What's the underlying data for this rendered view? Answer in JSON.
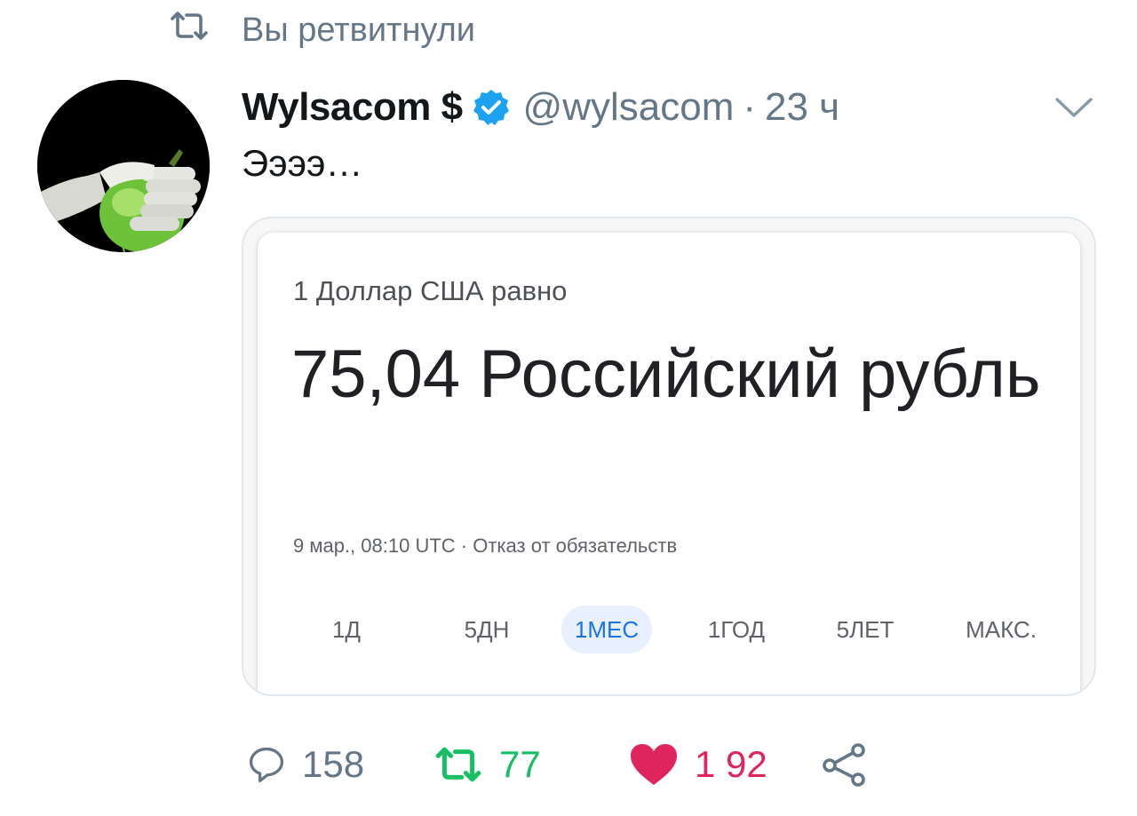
{
  "retweet_banner": {
    "icon": "retweet-icon",
    "text": "Вы ретвитнули"
  },
  "tweet": {
    "author_name": "Wylsacom $",
    "verified_icon": "verified-badge-icon",
    "handle": "@wylsacom",
    "separator": "·",
    "time": "23 ч",
    "text": "Ээээ…"
  },
  "card": {
    "label": "1 Доллар США равно",
    "value": "75,04 Российский рубль",
    "meta": "9 мар., 08:10 UTC · Отказ от обязательств",
    "ranges": [
      "1Д",
      "5ДН",
      "1МЕС",
      "1ГОД",
      "5ЛЕТ",
      "МАКС."
    ],
    "active_range": "1МЕС"
  },
  "actions": {
    "reply_count": "158",
    "retweet_count": "77",
    "like_count": "1 92"
  },
  "colors": {
    "retweet_active": "#17bf63",
    "like_active": "#e0245e",
    "verified": "#1da1f2",
    "muted": "#657786",
    "range_active": "#1a73e8"
  }
}
